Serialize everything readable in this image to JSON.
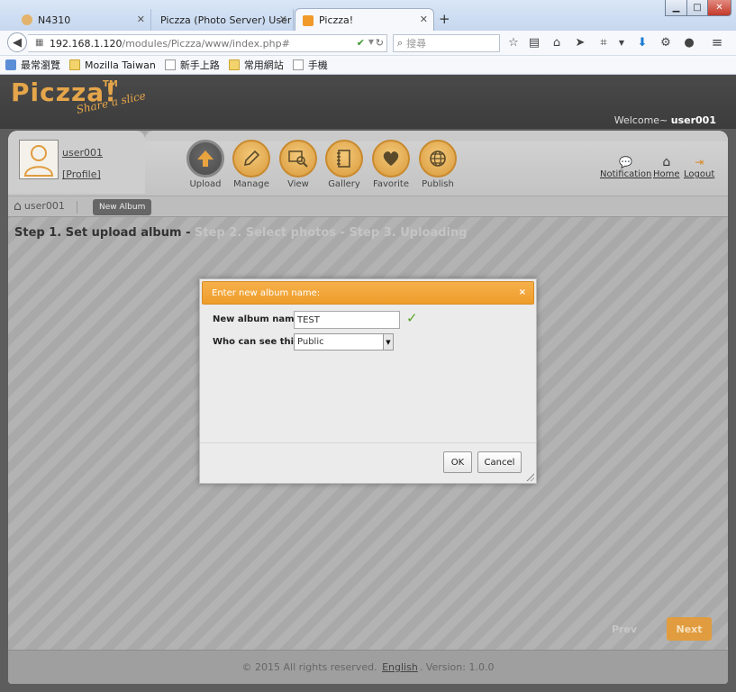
{
  "browser": {
    "tabs": [
      {
        "title": "N4310"
      },
      {
        "title": "Piczza (Photo Server) User G..."
      },
      {
        "title": "Piczza!"
      }
    ],
    "url_host": "192.168.1.120",
    "url_path": "/modules/Piczza/www/index.php#",
    "search_placeholder": "搜尋",
    "bookmarks": [
      "最常瀏覽",
      "Mozilla Taiwan",
      "新手上路",
      "常用網站",
      "手機"
    ]
  },
  "app": {
    "logo": "Piczza!",
    "logo_tm": "TM",
    "slogan": "Share a slice",
    "welcome_prefix": "Welcome~ ",
    "welcome_user": "user001",
    "profile": {
      "username": "user001",
      "profile_link": "[Profile]"
    },
    "toolbar": [
      {
        "label": "Upload"
      },
      {
        "label": "Manage"
      },
      {
        "label": "View"
      },
      {
        "label": "Gallery"
      },
      {
        "label": "Favorite"
      },
      {
        "label": "Publish"
      }
    ],
    "right_nav": [
      {
        "label": "Notification"
      },
      {
        "label": "Home"
      },
      {
        "label": "Logout"
      }
    ],
    "breadcrumb": {
      "home": "user001",
      "current": "New Album"
    },
    "steps": {
      "step1": "Step 1. Set upload album",
      "sep1": " - ",
      "step2": "Step 2. Select photos",
      "sep2": " - ",
      "step3": "Step 3. Uploading"
    },
    "prev_label": "Prev",
    "next_label": "Next",
    "footer": {
      "copyright": "© 2015 All rights reserved.",
      "language": "English",
      "version": ". Version: 1.0.0"
    }
  },
  "dialog": {
    "title": "Enter new album name:",
    "close": "×",
    "album_name_label": "New album name:",
    "album_name_value": "TEST",
    "visibility_label": "Who can see this:",
    "visibility_value": "Public",
    "ok_label": "OK",
    "cancel_label": "Cancel"
  },
  "colors": {
    "accent": "#ee9d2b",
    "next_button": "#e09c3f",
    "check": "#5aa32a"
  }
}
